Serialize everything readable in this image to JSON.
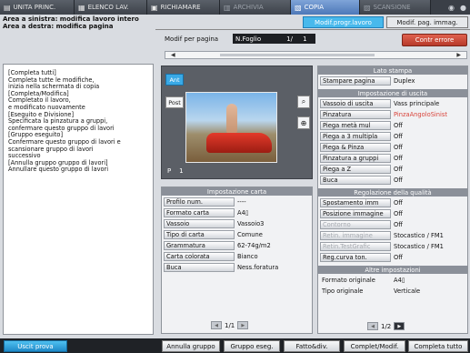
{
  "top_tabs": [
    {
      "label": "UNITA PRINC.",
      "icon": "home-icon",
      "active": false
    },
    {
      "label": "ELENCO LAV.",
      "icon": "list-icon",
      "active": false
    },
    {
      "label": "RICHIAMARE",
      "icon": "recall-icon",
      "active": false
    },
    {
      "label": "ARCHIVIA",
      "icon": "archive-icon",
      "active": false
    },
    {
      "label": "COPIA",
      "icon": "copy-icon",
      "active": true
    },
    {
      "label": "SCANSIONE",
      "icon": "scan-icon",
      "active": false
    }
  ],
  "header": {
    "line1": "Area a sinistra: modifica lavoro intero",
    "line2": "Area a destra: modifica pagina",
    "tab_active": "Modif.progr.lavoro",
    "tab_other": "Modif. pag. immag."
  },
  "page_edit": {
    "label": "Modif per pagina",
    "sheet": "N.Foglio",
    "page": "1/",
    "total": "1",
    "error_button": "Contr errore"
  },
  "message": "[Completa tutti]\nCompleta tutte le modifiche,\ninizia nella schermata di copia\n[Completa/Modifica]\nCompletato il lavoro,\ne modificato nuovamente\n[Eseguito e Divisione]\nSpecificata la pinzatura a gruppi,\nconfermare questo gruppo di lavori\n[Gruppo eseguito]\nConfermare questo gruppo di lavori e\nscansionare gruppo di lavori\nsuccessivo\n[Annulla gruppo gruppo di lavori]\nAnnullare questo gruppo di lavori",
  "preview": {
    "front_label": "Ant",
    "back_label": "Post",
    "page_label": "P",
    "page_num": "1"
  },
  "paper_settings": {
    "title": "Impostazione carta",
    "rows": [
      {
        "key": "Profilo num.",
        "value": "----"
      },
      {
        "key": "Formato carta",
        "value": "A4▯"
      },
      {
        "key": "Vassoio",
        "value": "Vassoio3"
      },
      {
        "key": "Tipo di carta",
        "value": "Comune"
      },
      {
        "key": "Grammatura",
        "value": "62-74g/m2"
      },
      {
        "key": "Carta colorata",
        "value": "Bianco"
      },
      {
        "key": "Buca",
        "value": "Ness.foratura"
      }
    ],
    "pager": "1/1"
  },
  "print_side": {
    "title": "Lato stampa",
    "key": "Stampare pagina",
    "value": "Duplex"
  },
  "output_settings": {
    "title": "Impostazione di uscita",
    "rows": [
      {
        "key": "Vassoio di uscita",
        "value": "Vass principale",
        "red": false
      },
      {
        "key": "Pinzatura",
        "value": "PinzaAngoloSinist",
        "red": true
      },
      {
        "key": "Piega metà mul",
        "value": "Off",
        "red": false
      },
      {
        "key": "Piega a 3 multipla",
        "value": "Off",
        "red": false
      },
      {
        "key": "Piega & Pinza",
        "value": "Off",
        "red": false
      },
      {
        "key": "Pinzatura a gruppi",
        "value": "Off",
        "red": false
      },
      {
        "key": "Piega a Z",
        "value": "Off",
        "red": false
      },
      {
        "key": "Buca",
        "value": "Off",
        "red": false
      }
    ]
  },
  "quality_settings": {
    "title": "Regolazione della qualità",
    "rows": [
      {
        "key": "Spostamento imm",
        "value": "Off",
        "disabled": false
      },
      {
        "key": "Posizione immagine",
        "value": "Off",
        "disabled": false
      },
      {
        "key": "Contorno",
        "value": "Off",
        "disabled": true
      },
      {
        "key": "Retin. immagine",
        "value": "Stocastico / FM1",
        "disabled": true
      },
      {
        "key": "Retin.TestGrafic",
        "value": "Stocastico / FM1",
        "disabled": true
      },
      {
        "key": "Reg.curva ton.",
        "value": "Off",
        "disabled": false
      }
    ]
  },
  "other_settings": {
    "title": "Altre impostazioni",
    "rows": [
      {
        "key": "Formato originale",
        "value": "A4▯"
      },
      {
        "key": "Tipo originale",
        "value": "Verticale"
      }
    ],
    "pager": "1/2"
  },
  "bottom": {
    "exit": "Uscit prova",
    "cancel_group": "Annulla gruppo",
    "group_done": "Gruppo eseg.",
    "done_div": "Fatto&div.",
    "complete_modify": "Complet/Modif.",
    "complete_all": "Completa tutto"
  }
}
